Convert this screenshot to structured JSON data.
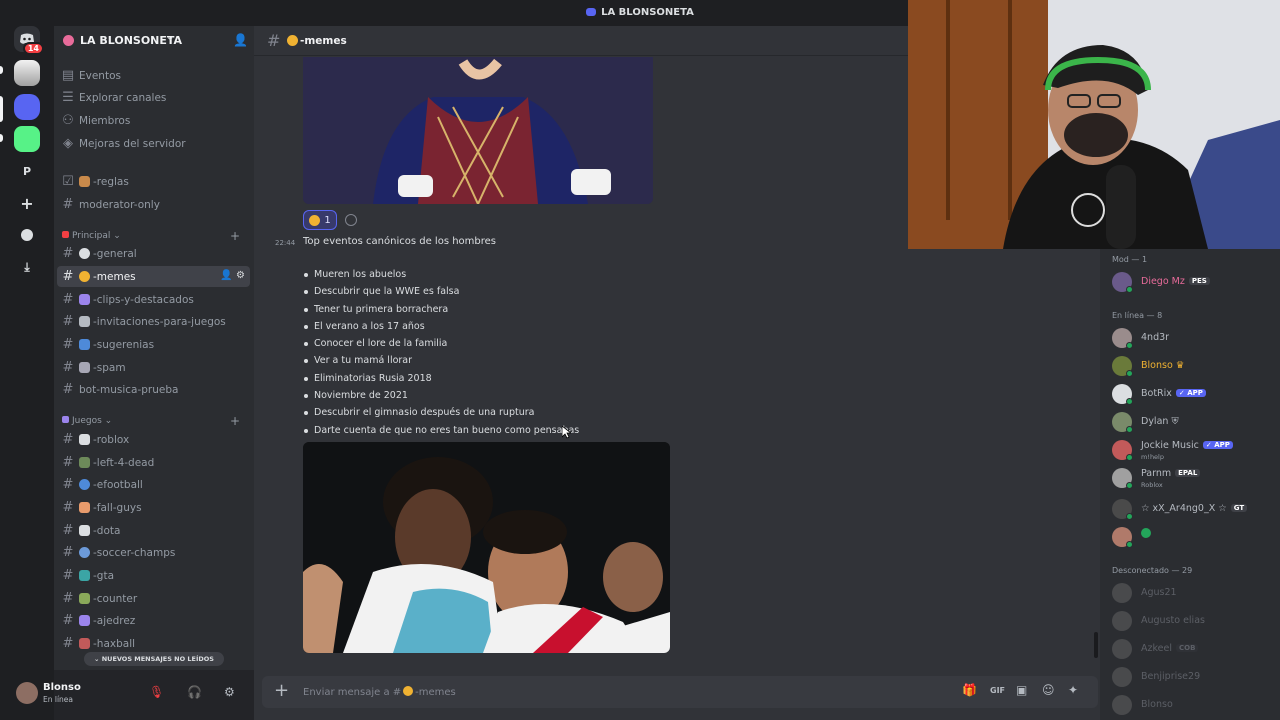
{
  "window": {
    "title": "LA BLONSONETA"
  },
  "rail": {
    "dm_badge": "14",
    "letter_server": "P"
  },
  "server": {
    "name": "LA BLONSONETA"
  },
  "sidebar": {
    "nav": [
      "Eventos",
      "Explorar canales",
      "Miembros",
      "Mejoras del servidor"
    ],
    "top_channels": [
      "-reglas",
      "moderator-only"
    ],
    "categories": [
      {
        "label": "Principal",
        "channels": [
          "-general",
          "-memes",
          "-clips-y-destacados",
          "-invitaciones-para-juegos",
          "-sugerenias",
          "-spam",
          "bot-musica-prueba"
        ]
      },
      {
        "label": "Juegos",
        "channels": [
          "-roblox",
          "-left-4-dead",
          "-efootball",
          "-fall-guys",
          "-dota",
          "-soccer-champs",
          "-gta",
          "-counter",
          "-ajedrez",
          "-haxball"
        ]
      }
    ],
    "active_channel": "-memes",
    "new_messages_pill": "NUEVOS MENSAJES NO LEÍDOS"
  },
  "user": {
    "name": "Blonso",
    "status": "En línea"
  },
  "chat": {
    "channel": "-memes",
    "reaction_count": "1",
    "message": {
      "time": "22:44",
      "text": "Top eventos canónicos de los hombres",
      "bullets": [
        "Mueren los abuelos",
        "Descubrir que la WWE es falsa",
        "Tener tu primera borrachera",
        "El verano a los 17 años",
        "Conocer el lore de la familia",
        "Ver a tu mamá llorar",
        "Eliminatorias Rusia 2018",
        "Noviembre de 2021",
        "Descubrir el gimnasio después de una ruptura",
        "Darte cuenta de que no eres tan bueno como pensabas"
      ]
    },
    "composer_placeholder": "Enviar mensaje a #"
  },
  "members": {
    "mod_header": "Mod — 1",
    "mods": [
      {
        "name": "Diego Mz",
        "tag": "PES",
        "color": "#e86b9a"
      }
    ],
    "online_header": "En línea — 8",
    "online": [
      {
        "name": "4nd3r",
        "color": "#b5bac1",
        "sub": "",
        "tag": ""
      },
      {
        "name": "Blonso",
        "color": "#f0b232",
        "sub": "",
        "tag": ""
      },
      {
        "name": "BotRix",
        "color": "#b5bac1",
        "sub": "",
        "tag": "APP"
      },
      {
        "name": "Dylan",
        "color": "#b5bac1",
        "sub": "",
        "tag": ""
      },
      {
        "name": "Jockie Music",
        "color": "#b5bac1",
        "sub": "m!help",
        "tag": "APP"
      },
      {
        "name": "Parnm",
        "color": "#b5bac1",
        "sub": "Roblox",
        "tag": "EPAL"
      },
      {
        "name": "☆ xX_Ar4ng0_X ☆",
        "color": "#b5bac1",
        "sub": "",
        "tag": "GT"
      },
      {
        "name": "",
        "color": "#b5bac1",
        "sub": "",
        "tag": ""
      }
    ],
    "offline_header": "Desconectado — 29",
    "offline": [
      {
        "name": "Agus21",
        "tag": ""
      },
      {
        "name": "Augusto elias",
        "tag": ""
      },
      {
        "name": "Azkeel",
        "tag": "COB"
      },
      {
        "name": "Benjiprise29",
        "tag": ""
      },
      {
        "name": "Blonso",
        "tag": ""
      }
    ]
  },
  "colors": {
    "accent": "#5865f2",
    "online": "#23a55a",
    "danger": "#f23f43",
    "app_tag": "#5865f2"
  },
  "icons": [
    "discord-icon",
    "add-member-icon",
    "settings-icon",
    "mic-muted-icon",
    "headphones-icon",
    "gift-icon",
    "gif-icon",
    "sticker-icon",
    "emoji-icon",
    "apps-icon"
  ]
}
